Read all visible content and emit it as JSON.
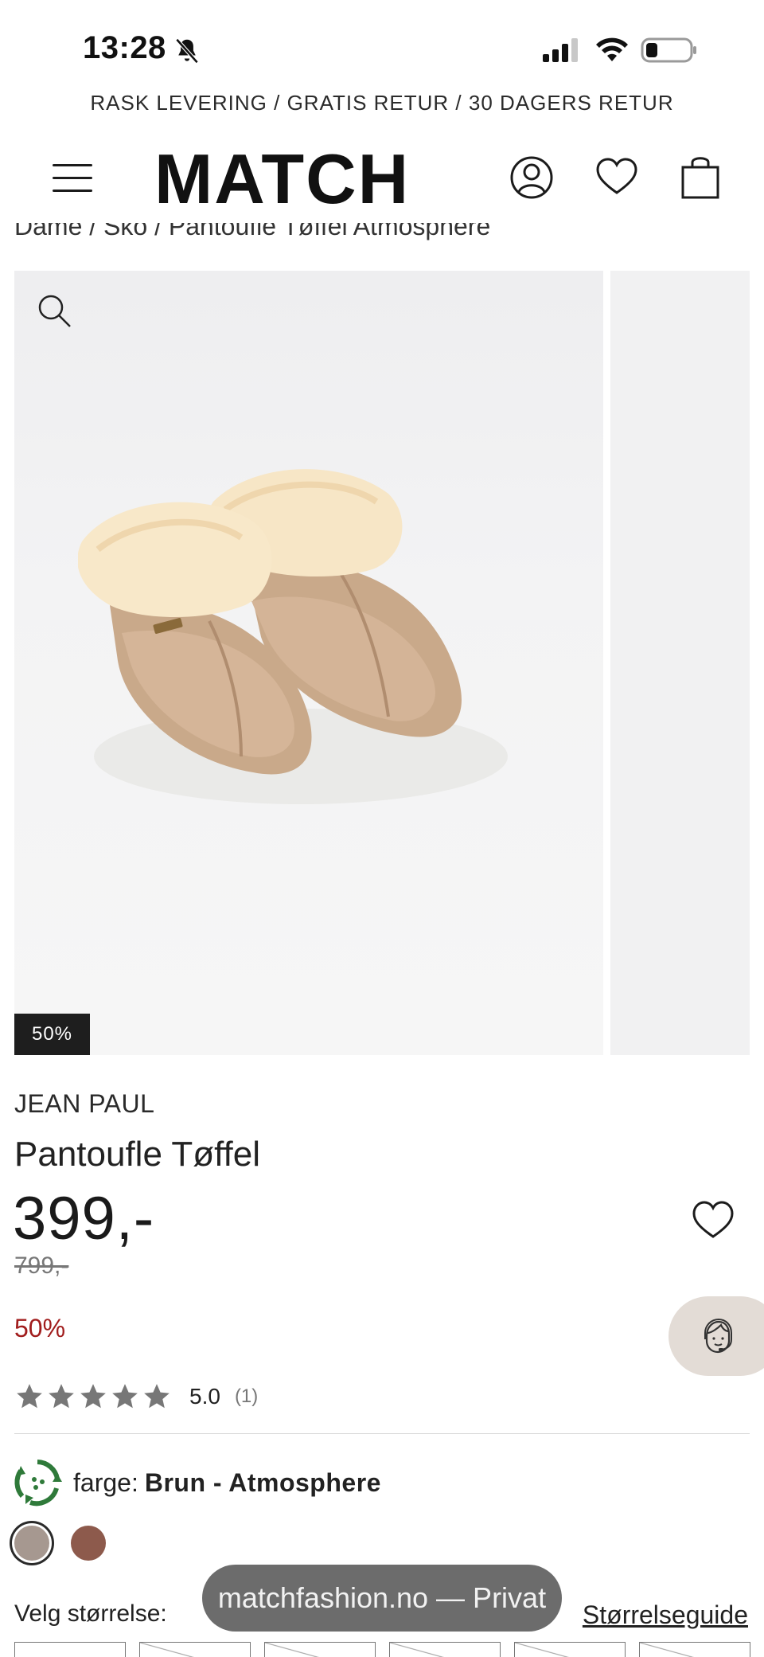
{
  "status_bar": {
    "time": "13:28",
    "icons": [
      "bell-slash-icon",
      "cellular-signal-icon",
      "wifi-icon",
      "battery-icon"
    ]
  },
  "promo": {
    "text": "RASK LEVERING / GRATIS RETUR / 30 DAGERS RETUR"
  },
  "header": {
    "logo": "MATCH",
    "icons": [
      "menu-icon",
      "account-icon",
      "heart-icon",
      "shopping-bag-icon"
    ]
  },
  "breadcrumb": {
    "text": "Dame  /  Sko  /  Pantoufle Tøffel Atmosphere"
  },
  "gallery": {
    "discount_tag": "50%"
  },
  "product": {
    "brand": "JEAN PAUL",
    "title": "Pantoufle Tøffel",
    "price": "399,-",
    "old_price": "799,-",
    "discount": "50%"
  },
  "rating": {
    "score": "5.0",
    "count": "(1)",
    "stars_value": 5
  },
  "color": {
    "label": "farge:",
    "value": "Brun - Atmosphere",
    "swatches": [
      "#a69890",
      "#8d5a4c"
    ]
  },
  "size": {
    "label": "Velg størrelse:",
    "guide": "Størrelseguide"
  },
  "browser": {
    "url_pill": "matchfashion.no — Privat"
  },
  "colors": {
    "discount_red": "#a11d1d",
    "chat_bg": "#e3dcd6",
    "star_gray": "#777777",
    "tag_bg": "#1e1e1e"
  }
}
